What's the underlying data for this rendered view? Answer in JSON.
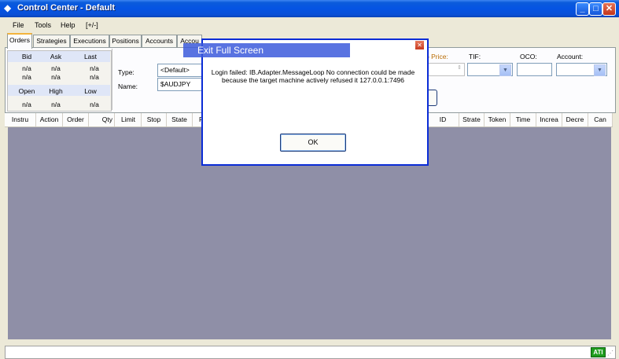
{
  "window": {
    "title": "Control Center - Default"
  },
  "menu": [
    "File",
    "Tools",
    "Help",
    "[+/-]"
  ],
  "tabs": [
    "Orders",
    "Strategies",
    "Executions",
    "Positions",
    "Accounts",
    "Accou"
  ],
  "quote": {
    "headers1": [
      "Bid",
      "Ask",
      "Last"
    ],
    "values1": [
      "n/a",
      "n/a",
      "n/a"
    ],
    "values2": [
      "n/a",
      "n/a",
      "n/a"
    ],
    "headers2": [
      "Open",
      "High",
      "Low"
    ],
    "values3": [
      "n/a",
      "n/a",
      "n/a"
    ]
  },
  "order_form": {
    "type_label": "Type:",
    "type_value": "<Default>",
    "name_label": "Name:",
    "name_value": "$AUDJPY",
    "stop_price_label": "p Price:",
    "tif_label": "TIF:",
    "oco_label": "OCO:",
    "account_label": "Account:"
  },
  "grid_columns_left": [
    "Instru",
    "Action",
    "Order",
    "Qty",
    "Limit",
    "Stop",
    "State",
    "F"
  ],
  "grid_columns_right": [
    "ID",
    "Strate",
    "Token",
    "Time",
    "Increa",
    "Decre",
    "Can"
  ],
  "status": {
    "badge": "ATI"
  },
  "overlay": {
    "exit_fullscreen": "Exit Full Screen"
  },
  "dialog": {
    "message_line1": "Login failed: IB.Adapter.MessageLoop No connection could be made",
    "message_line2": "because the target machine actively refused it 127.0.0.1:7496",
    "ok_label": "OK"
  }
}
